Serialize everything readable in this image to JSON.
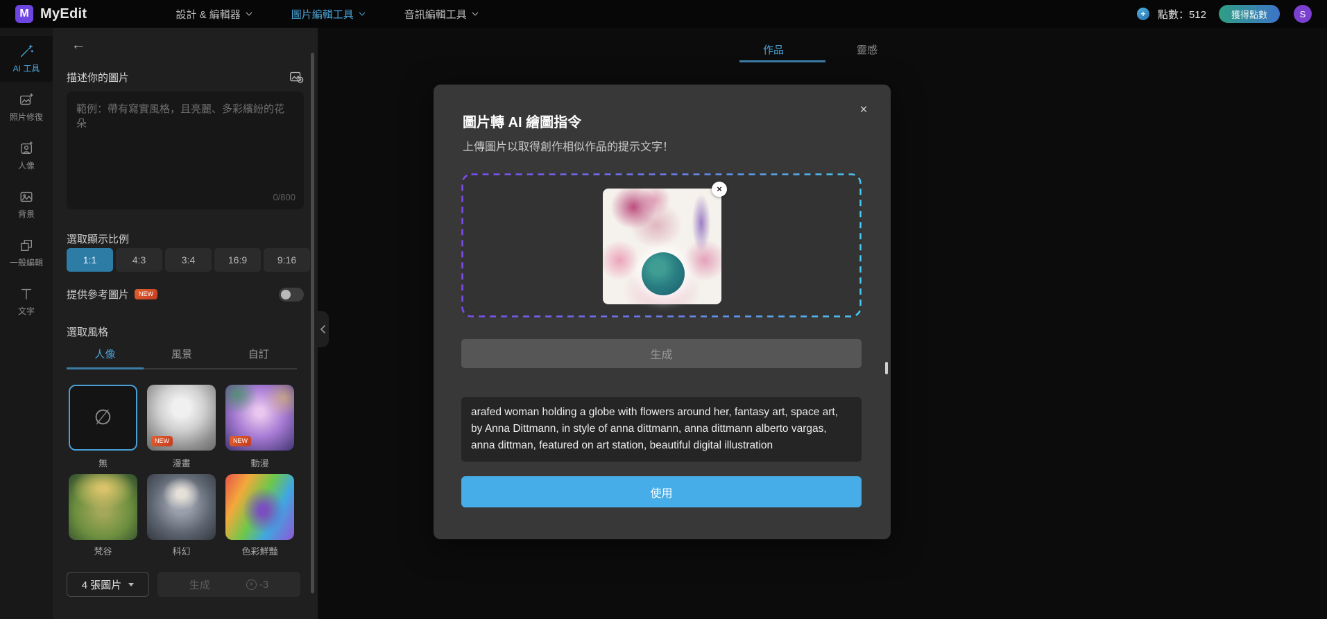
{
  "navbar": {
    "logo_text": "MyEdit",
    "menus": [
      {
        "label": "設計 & 編輯器"
      },
      {
        "label": "圖片編輯工具"
      },
      {
        "label": "音訊編輯工具"
      }
    ],
    "credits": "點數：512",
    "get_credits_label": "獲得點數",
    "avatar_initial": "S"
  },
  "rail": {
    "items": [
      {
        "label": "AI 工具"
      },
      {
        "label": "照片修復"
      },
      {
        "label": "人像"
      },
      {
        "label": "背景"
      },
      {
        "label": "一般編輯"
      },
      {
        "label": "文字"
      }
    ]
  },
  "panel": {
    "describe_label": "描述你的圖片",
    "textarea_placeholder": "範例：帶有寫實風格，且亮麗、多彩繽紛的花朵",
    "char_counter": "0/800",
    "ratio_label": "選取顯示比例",
    "ratios": [
      "1:1",
      "4:3",
      "3:4",
      "16:9",
      "9:16"
    ],
    "active_ratio": "1:1",
    "reference_label": "提供參考圖片",
    "new_badge": "NEW",
    "style_label": "選取風格",
    "style_tabs": [
      "人像",
      "風景",
      "自訂"
    ],
    "active_style_tab": "人像",
    "styles": [
      {
        "label": "無",
        "badge": ""
      },
      {
        "label": "漫畫",
        "badge": "NEW"
      },
      {
        "label": "動漫",
        "badge": "NEW"
      },
      {
        "label": "梵谷",
        "badge": ""
      },
      {
        "label": "科幻",
        "badge": ""
      },
      {
        "label": "色彩鮮豔",
        "badge": ""
      }
    ],
    "none_glyph": "∅",
    "count_dropdown": "4 張圖片",
    "generate_label": "生成",
    "generate_cost": "-3"
  },
  "workspace": {
    "tabs": [
      "作品",
      "靈感"
    ],
    "active_tab": "作品"
  },
  "modal": {
    "title": "圖片轉 AI 繪圖指令",
    "subtitle": "上傳圖片以取得創作相似作品的提示文字！",
    "close_label": "×",
    "remove_image_label": "×",
    "generate_label": "生成",
    "prompt_text": "arafed woman holding a globe with flowers around her, fantasy art, space art, by Anna Dittmann, in style of anna dittmann, anna dittmann alberto vargas, anna dittman, featured on art station, beautiful digital illustration",
    "use_label": "使用"
  },
  "colors": {
    "accent_blue": "#4aa3d8",
    "ratio_active_blue": "#2d7ca6",
    "use_button_blue": "#47ade8",
    "new_badge_orange": "#d8502c",
    "credits_gradient_start": "#2f9e83",
    "credits_gradient_end": "#3e74c9",
    "avatar_purple": "#7b40d0",
    "logo_purple": "#6d45e0",
    "dash_gradient_start": "#7d4df2",
    "dash_gradient_end": "#49c8f2"
  }
}
